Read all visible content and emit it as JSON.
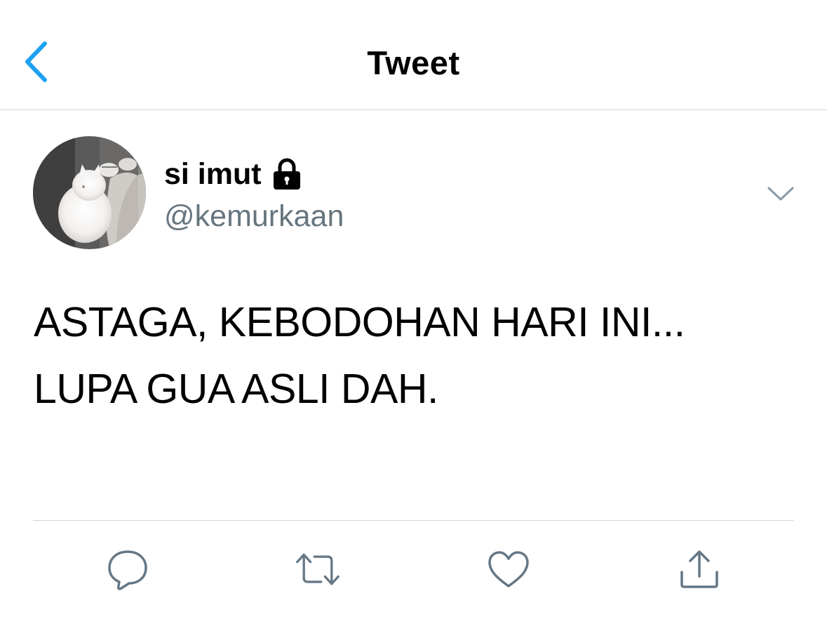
{
  "header": {
    "title": "Tweet",
    "back_icon": "chevron-left-icon",
    "accent_color": "#1da1f2"
  },
  "tweet": {
    "author": {
      "display_name": "si imut",
      "handle": "@kemurkaan",
      "protected_icon": "lock-icon",
      "avatar": "avatar-white-kitten"
    },
    "menu_icon": "chevron-down-icon",
    "text_lines": [
      "ASTAGA, KEBODOHAN HARI INI...",
      "LUPA GUA ASLI DAH."
    ]
  },
  "actions": [
    {
      "name": "reply",
      "icon": "comment-icon"
    },
    {
      "name": "retweet",
      "icon": "retweet-icon"
    },
    {
      "name": "like",
      "icon": "heart-icon"
    },
    {
      "name": "share",
      "icon": "share-icon"
    }
  ],
  "colors": {
    "text_primary": "#000000",
    "text_secondary": "#66757f",
    "icon_gray": "#657786",
    "divider": "#cfd9de"
  }
}
